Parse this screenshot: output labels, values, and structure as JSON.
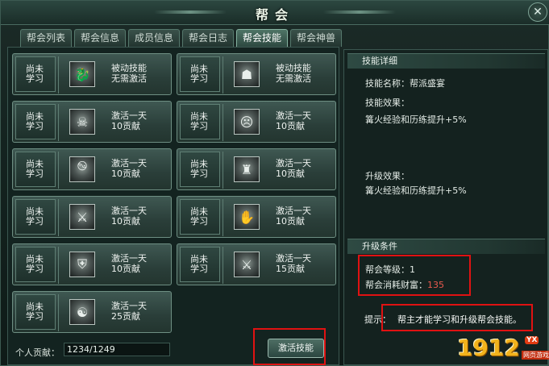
{
  "window": {
    "title": "帮会"
  },
  "tabs": [
    {
      "label": "帮会列表",
      "active": false
    },
    {
      "label": "帮会信息",
      "active": false
    },
    {
      "label": "成员信息",
      "active": false
    },
    {
      "label": "帮会日志",
      "active": false
    },
    {
      "label": "帮会技能",
      "active": true
    },
    {
      "label": "帮会神兽",
      "active": false
    }
  ],
  "skills": [
    {
      "status": "尚未学习",
      "line1": "被动技能",
      "line2": "无需激活",
      "icon": "dragon-icon"
    },
    {
      "status": "尚未学习",
      "line1": "被动技能",
      "line2": "无需激活",
      "icon": "warrior-helmet-icon"
    },
    {
      "status": "尚未学习",
      "line1": "激活一天",
      "line2": "10贡献",
      "icon": "beast-face-icon"
    },
    {
      "status": "尚未学习",
      "line1": "激活一天",
      "line2": "10贡献",
      "icon": "demon-mask-icon"
    },
    {
      "status": "尚未学习",
      "line1": "激活一天",
      "line2": "10贡献",
      "icon": "whirlwind-icon"
    },
    {
      "status": "尚未学习",
      "line1": "激活一天",
      "line2": "10贡献",
      "icon": "figure-icon"
    },
    {
      "status": "尚未学习",
      "line1": "激活一天",
      "line2": "10贡献",
      "icon": "slash-icon"
    },
    {
      "status": "尚未学习",
      "line1": "激活一天",
      "line2": "10贡献",
      "icon": "claw-icon"
    },
    {
      "status": "尚未学习",
      "line1": "激活一天",
      "line2": "10贡献",
      "icon": "shield-emblem-icon"
    },
    {
      "status": "尚未学习",
      "line1": "激活一天",
      "line2": "15贡献",
      "icon": "sword-icon"
    },
    {
      "status": "尚未学习",
      "line1": "激活一天",
      "line2": "25贡献",
      "icon": "spirit-icon"
    }
  ],
  "footer": {
    "contribution_label": "个人贡献：",
    "contribution_value": "1234/1249",
    "activate_button": "激活技能"
  },
  "detail": {
    "header": "技能详细",
    "name_line": "技能名称：帮派盛宴",
    "effect_label": "技能效果：",
    "effect_text": "篝火经验和历练提升+5%",
    "upgrade_label": "升级效果：",
    "upgrade_text": "篝火经验和历练提升+5%"
  },
  "conditions": {
    "header": "升级条件",
    "level_line": "帮会等级：1",
    "wealth_label": "帮会消耗财富：",
    "wealth_value": "135"
  },
  "tip": {
    "label": "提示：",
    "text": "帮主才能学习和升级帮会技能。"
  },
  "watermark": {
    "number": "1912",
    "badge": "YX",
    "sub": "网页游戏"
  },
  "colors": {
    "highlight_box": "#e01212",
    "wealth_value": "#e8594e",
    "accent": "#86b3a1"
  }
}
